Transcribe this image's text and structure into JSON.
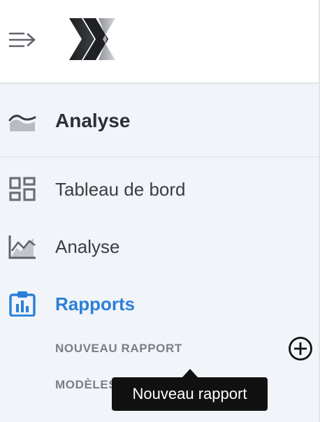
{
  "header": {
    "menu_icon": "collapse-menu-icon",
    "logo_icon": "x-logo"
  },
  "section": {
    "title": "Analyse",
    "icon": "area-wave-icon"
  },
  "nav": {
    "items": [
      {
        "label": "Tableau de bord",
        "icon": "dashboard-icon"
      },
      {
        "label": "Analyse",
        "icon": "line-chart-icon"
      },
      {
        "label": "Rapports",
        "icon": "clipboard-chart-icon"
      }
    ],
    "sub_items": [
      {
        "label": "NOUVEAU RAPPORT"
      },
      {
        "label": "MODÈLES"
      }
    ]
  },
  "add_button_icon": "plus-circle-icon",
  "tooltip": {
    "text": "Nouveau rapport"
  },
  "colors": {
    "active": "#2b7fd9",
    "background": "#f1f4f8",
    "text": "#3a3d42",
    "muted": "#7a7e85",
    "tooltip_bg": "#111111"
  }
}
